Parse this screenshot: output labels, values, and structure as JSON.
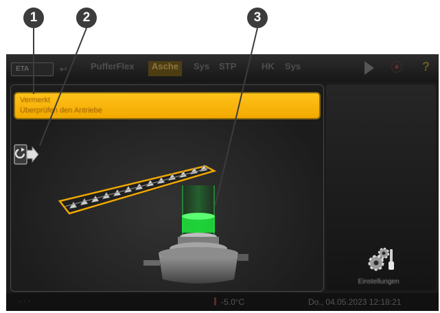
{
  "callouts": [
    "1",
    "2",
    "3"
  ],
  "topbar": {
    "logo": "ETA",
    "tabs": [
      "PufferFlex",
      "Asche",
      "Sys",
      "STP",
      "HK",
      "Sys"
    ],
    "active_tab": "Asche"
  },
  "alert": {
    "line1": "Vermerkt",
    "line2": "Überprüfen den Antriebe"
  },
  "side": {
    "settings_label": "Einstellungen"
  },
  "status": {
    "left": "· · ·",
    "temperature": "-5.0°C",
    "datetime": "Do., 04.05.2023 12:18:21"
  },
  "colors": {
    "accent": "#f5b400",
    "level": "#1ee63c"
  },
  "icons": [
    "drive-direction-icon",
    "settings-gear-icon",
    "play-icon",
    "eye-icon",
    "help-icon",
    "thermometer-icon"
  ]
}
